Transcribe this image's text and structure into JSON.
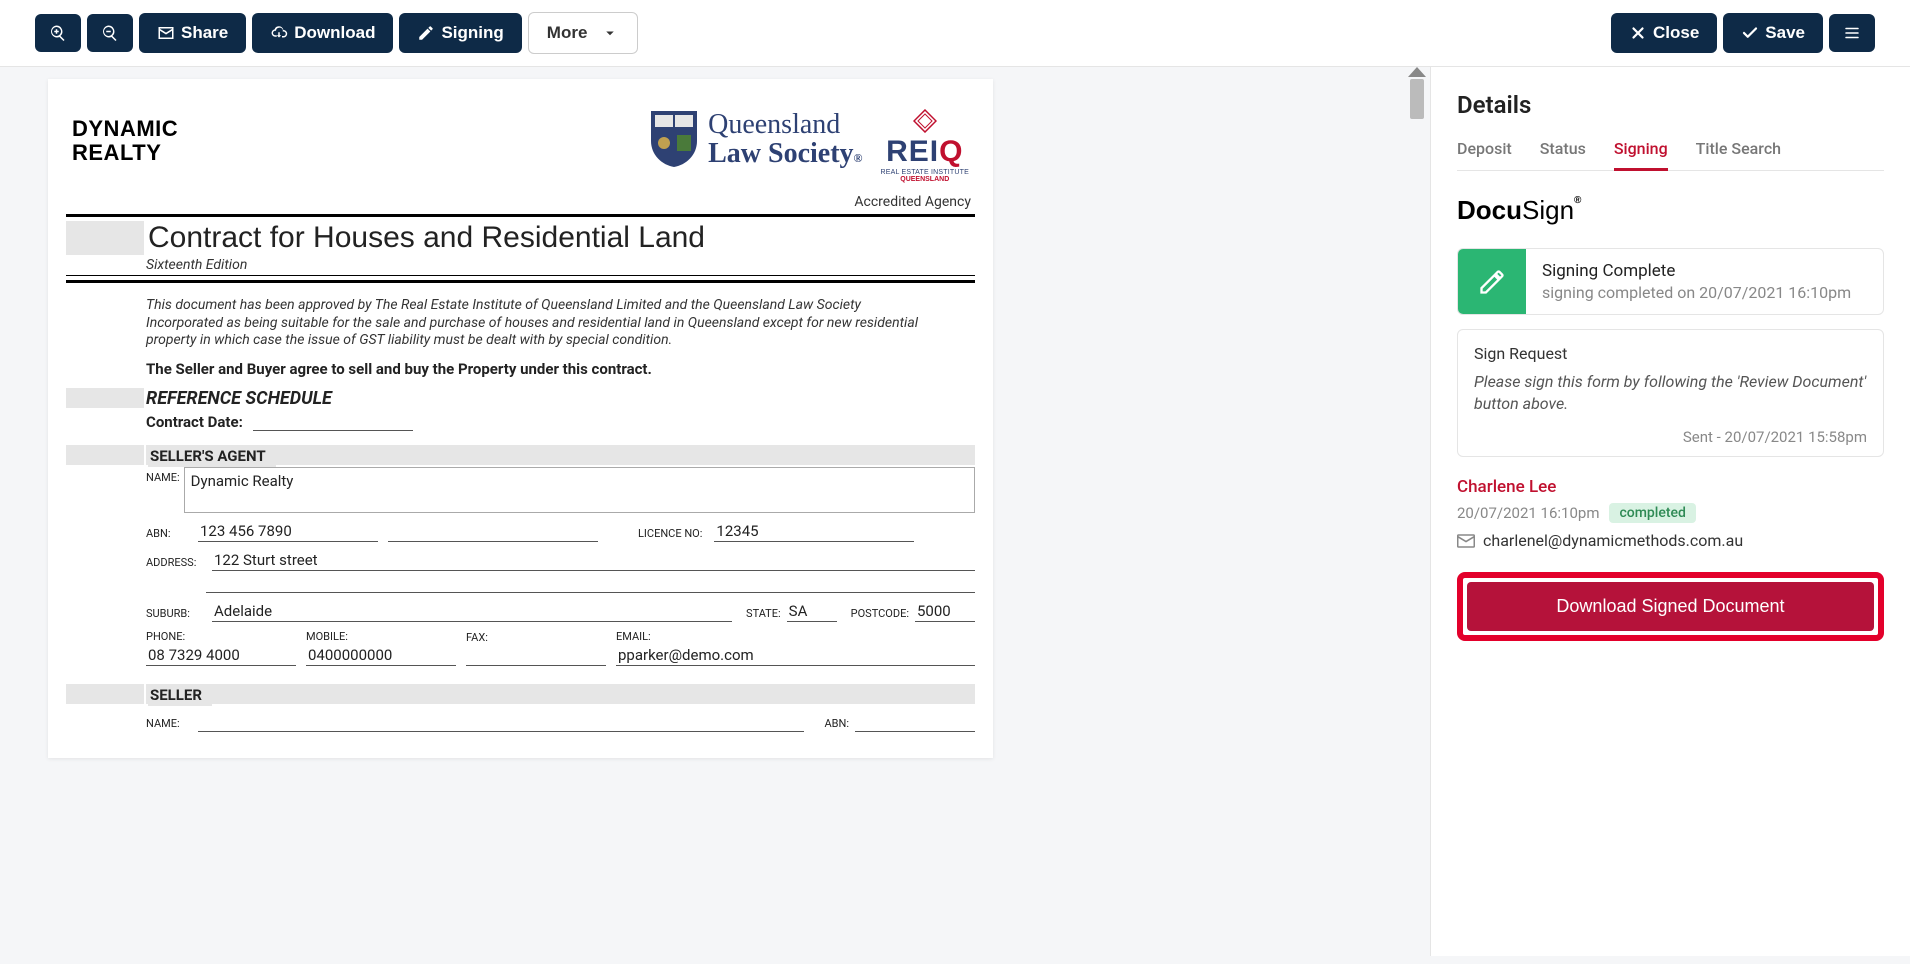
{
  "toolbar": {
    "share_label": "Share",
    "download_label": "Download",
    "signing_label": "Signing",
    "more_label": "More",
    "close_label": "Close",
    "save_label": "Save"
  },
  "document": {
    "brand": {
      "line1": "DYNAMIC",
      "line2": "REALTY"
    },
    "qls": {
      "line1": "Queensland",
      "line2": "Law Society"
    },
    "reiq": {
      "sub1": "REAL ESTATE INSTITUTE",
      "sub2": "QUEENSLAND",
      "accredited": "Accredited Agency"
    },
    "title": "Contract for Houses and Residential Land",
    "edition": "Sixteenth Edition",
    "approval": "This document has been approved by The Real Estate Institute of Queensland Limited and the Queensland Law Society Incorporated as being suitable for the sale and purchase of houses and residential land in Queensland except for new residential property in which case the issue of GST liability must be dealt with by special condition.",
    "agree": "The Seller and Buyer agree to sell and buy the Property under this contract.",
    "reference_schedule": "REFERENCE SCHEDULE",
    "contract_date_label": "Contract Date:",
    "sellers_agent_heading": "SELLER'S AGENT",
    "seller_heading": "SELLER",
    "labels": {
      "name": "NAME:",
      "abn": "ABN:",
      "licence_no": "LICENCE NO:",
      "address": "ADDRESS:",
      "suburb": "SUBURB:",
      "state": "STATE:",
      "postcode": "POSTCODE:",
      "phone": "PHONE:",
      "mobile": "MOBILE:",
      "fax": "FAX:",
      "email": "EMAIL:"
    },
    "agent": {
      "name": "Dynamic Realty",
      "abn": "123 456 7890",
      "licence_no": "12345",
      "address": "122 Sturt street",
      "suburb": "Adelaide",
      "state": "SA",
      "postcode": "5000",
      "phone": "08 7329 4000",
      "mobile": "0400000000",
      "fax": "",
      "email": "pparker@demo.com"
    }
  },
  "side": {
    "title": "Details",
    "tabs": {
      "deposit": "Deposit",
      "status": "Status",
      "signing": "Signing",
      "title_search": "Title Search"
    },
    "docusign": "DocuSign",
    "status": {
      "heading": "Signing Complete",
      "detail": "signing completed on 20/07/2021 16:10pm"
    },
    "request": {
      "heading": "Sign Request",
      "message": "Please sign this form by following the 'Review Document' button above.",
      "sent": "Sent - 20/07/2021 15:58pm"
    },
    "signer": {
      "name": "Charlene Lee",
      "ts": "20/07/2021 16:10pm",
      "badge": "completed",
      "email": "charlenel@dynamicmethods.com.au"
    },
    "download_btn": "Download Signed Document"
  }
}
